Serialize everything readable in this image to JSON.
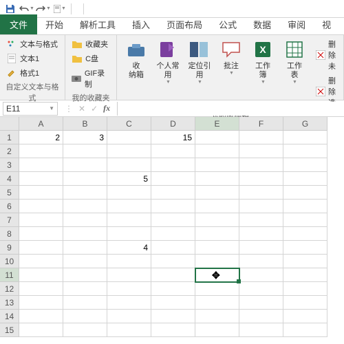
{
  "qat": {
    "save": "保存",
    "undo": "撤销",
    "redo": "重做"
  },
  "tabs": {
    "file": "文件",
    "home": "开始",
    "parse": "解析工具",
    "insert": "插入",
    "layout": "页面布局",
    "formulas": "公式",
    "data": "数据",
    "review": "审阅",
    "view": "视"
  },
  "ribbon": {
    "group1": {
      "label": "自定义文本与格式",
      "items": [
        "文本与格式",
        "文本1",
        "格式1"
      ]
    },
    "group2": {
      "label": "我的收藏夹",
      "items": [
        "收藏夹",
        "C盘",
        "GIF录制"
      ]
    },
    "group3": {
      "label": "我的收纳箱",
      "storage": "收\n纳箱",
      "personal": "个人常\n用",
      "locate": "定位引\n用",
      "annotate": "批注",
      "workbook": "工作\n簿",
      "worksheet": "工作\n表",
      "del_unused_s": "删除未",
      "del_unsel_s": "删除选"
    }
  },
  "formula_bar": {
    "cell_ref": "E11",
    "value": ""
  },
  "columns": [
    "A",
    "B",
    "C",
    "D",
    "E",
    "F",
    "G"
  ],
  "selected_col_idx": 4,
  "row_count": 15,
  "selected_row": 11,
  "chart_data": {
    "type": "table",
    "title": "",
    "columns": [
      "A",
      "B",
      "C",
      "D",
      "E",
      "F",
      "G"
    ],
    "rows": 15,
    "cells": [
      {
        "r": 1,
        "c": "A",
        "v": 2
      },
      {
        "r": 1,
        "c": "B",
        "v": 3
      },
      {
        "r": 1,
        "c": "D",
        "v": 15
      },
      {
        "r": 4,
        "c": "C",
        "v": 5
      },
      {
        "r": 9,
        "c": "C",
        "v": 4
      }
    ],
    "selected_cell": "E11"
  },
  "colors": {
    "accent": "#217346",
    "grid_border": "#d4d4d4",
    "header_bg": "#e6e6e6"
  }
}
